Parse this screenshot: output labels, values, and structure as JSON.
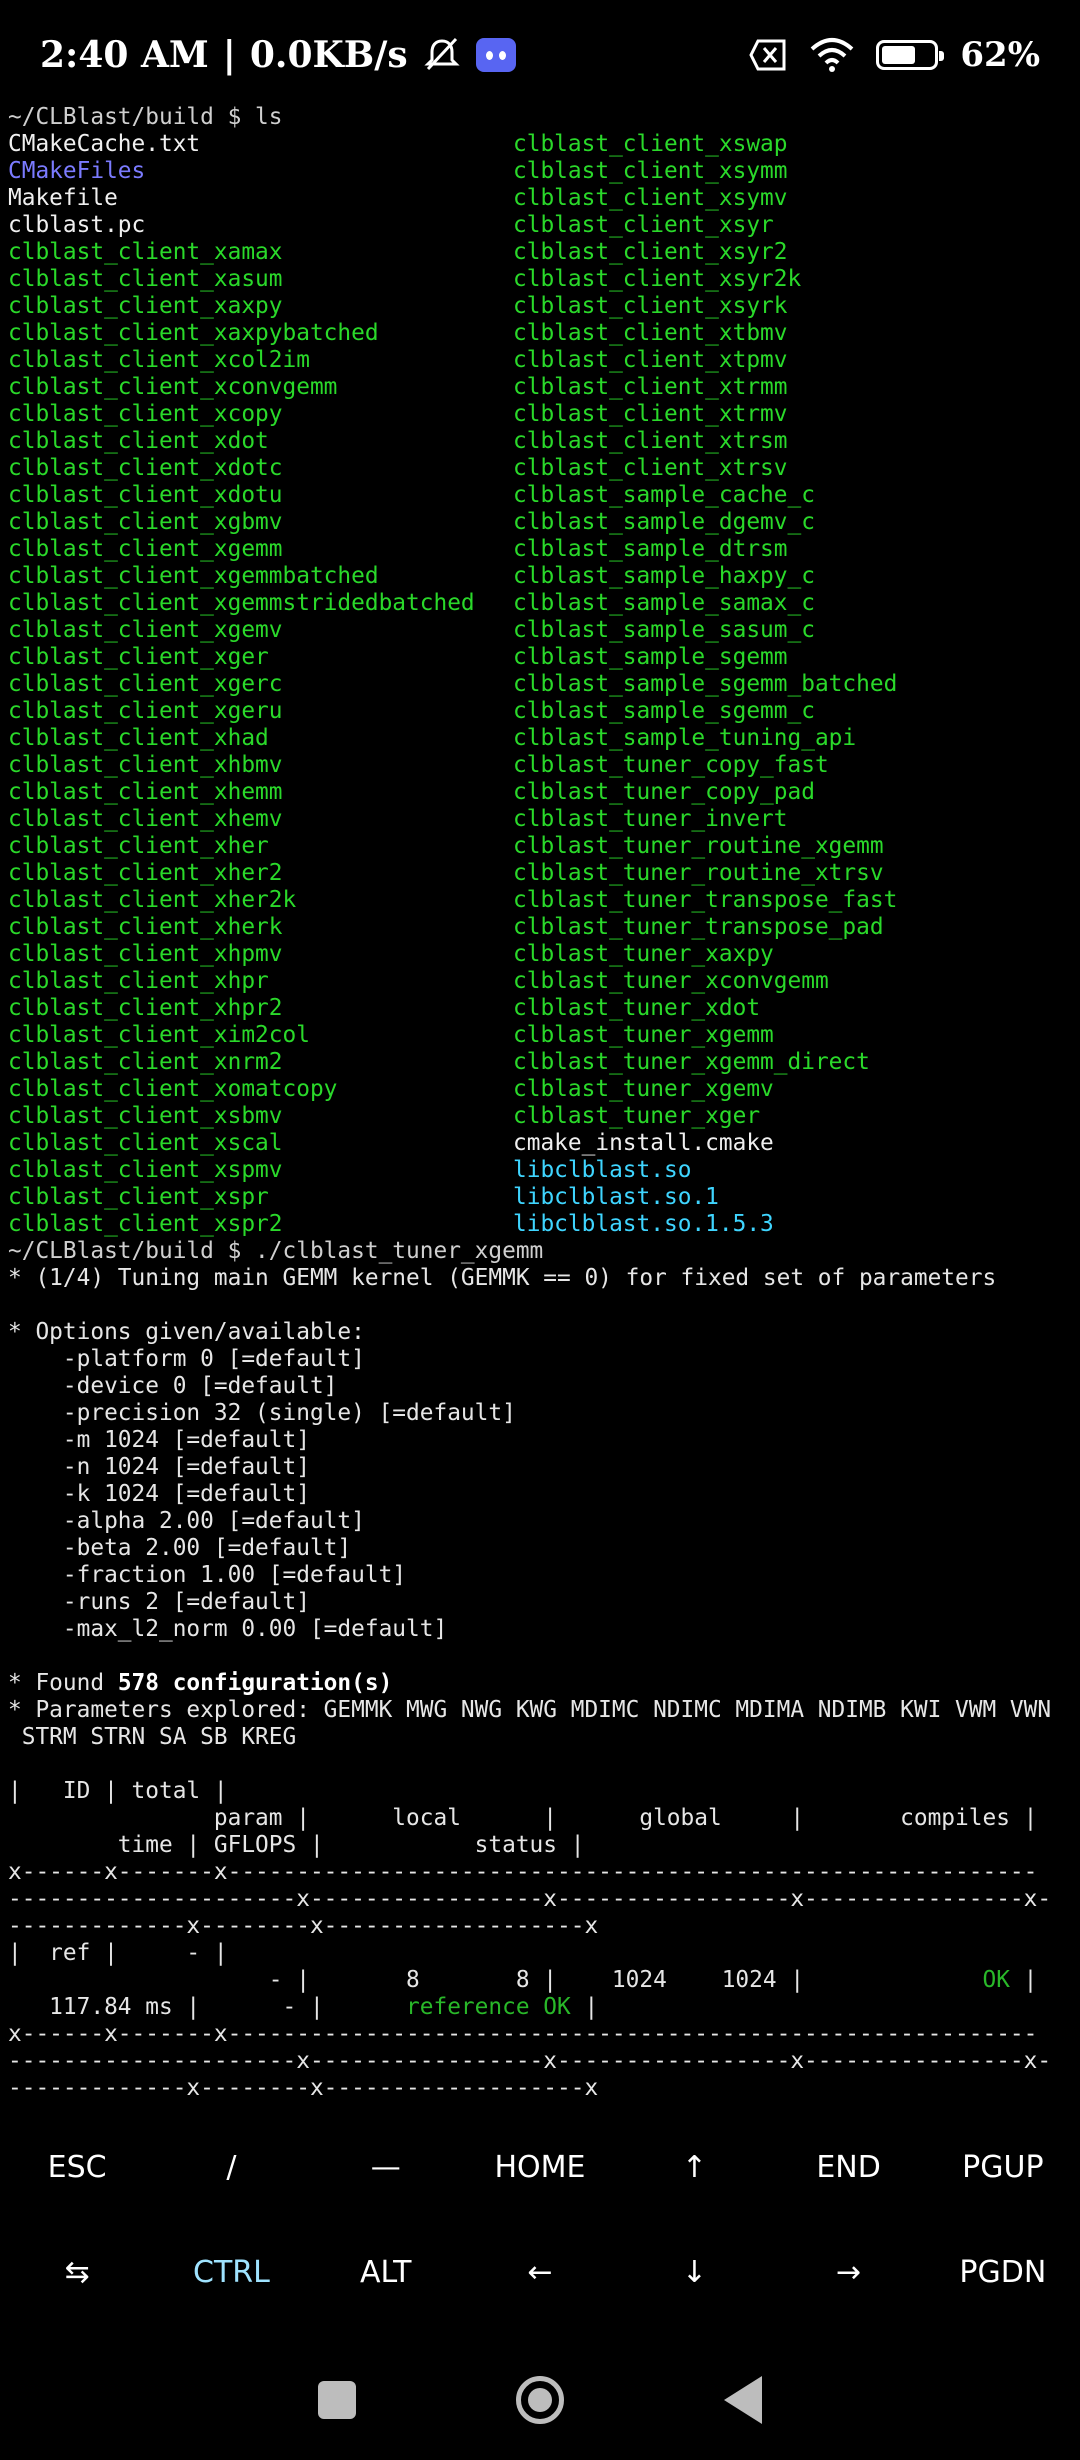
{
  "status": {
    "time": "2:40 AM",
    "separator": "|",
    "speed": "0.0KB/s",
    "battery": "62%",
    "battery_level": 0.62
  },
  "terminal": {
    "prompt1": "~/CLBlast/build $ ls",
    "ls_left": [
      {
        "t": "CMakeCache.txt",
        "k": "plain"
      },
      {
        "t": "CMakeFiles",
        "k": "dir"
      },
      {
        "t": "Makefile",
        "k": "plain"
      },
      {
        "t": "clblast.pc",
        "k": "plain"
      },
      {
        "t": "clblast_client_xamax",
        "k": "exe"
      },
      {
        "t": "clblast_client_xasum",
        "k": "exe"
      },
      {
        "t": "clblast_client_xaxpy",
        "k": "exe"
      },
      {
        "t": "clblast_client_xaxpybatched",
        "k": "exe"
      },
      {
        "t": "clblast_client_xcol2im",
        "k": "exe"
      },
      {
        "t": "clblast_client_xconvgemm",
        "k": "exe"
      },
      {
        "t": "clblast_client_xcopy",
        "k": "exe"
      },
      {
        "t": "clblast_client_xdot",
        "k": "exe"
      },
      {
        "t": "clblast_client_xdotc",
        "k": "exe"
      },
      {
        "t": "clblast_client_xdotu",
        "k": "exe"
      },
      {
        "t": "clblast_client_xgbmv",
        "k": "exe"
      },
      {
        "t": "clblast_client_xgemm",
        "k": "exe"
      },
      {
        "t": "clblast_client_xgemmbatched",
        "k": "exe"
      },
      {
        "t": "clblast_client_xgemmstridedbatched",
        "k": "exe"
      },
      {
        "t": "clblast_client_xgemv",
        "k": "exe"
      },
      {
        "t": "clblast_client_xger",
        "k": "exe"
      },
      {
        "t": "clblast_client_xgerc",
        "k": "exe"
      },
      {
        "t": "clblast_client_xgeru",
        "k": "exe"
      },
      {
        "t": "clblast_client_xhad",
        "k": "exe"
      },
      {
        "t": "clblast_client_xhbmv",
        "k": "exe"
      },
      {
        "t": "clblast_client_xhemm",
        "k": "exe"
      },
      {
        "t": "clblast_client_xhemv",
        "k": "exe"
      },
      {
        "t": "clblast_client_xher",
        "k": "exe"
      },
      {
        "t": "clblast_client_xher2",
        "k": "exe"
      },
      {
        "t": "clblast_client_xher2k",
        "k": "exe"
      },
      {
        "t": "clblast_client_xherk",
        "k": "exe"
      },
      {
        "t": "clblast_client_xhpmv",
        "k": "exe"
      },
      {
        "t": "clblast_client_xhpr",
        "k": "exe"
      },
      {
        "t": "clblast_client_xhpr2",
        "k": "exe"
      },
      {
        "t": "clblast_client_xim2col",
        "k": "exe"
      },
      {
        "t": "clblast_client_xnrm2",
        "k": "exe"
      },
      {
        "t": "clblast_client_xomatcopy",
        "k": "exe"
      },
      {
        "t": "clblast_client_xsbmv",
        "k": "exe"
      },
      {
        "t": "clblast_client_xscal",
        "k": "exe"
      },
      {
        "t": "clblast_client_xspmv",
        "k": "exe"
      },
      {
        "t": "clblast_client_xspr",
        "k": "exe"
      },
      {
        "t": "clblast_client_xspr2",
        "k": "exe"
      }
    ],
    "ls_right": [
      {
        "t": "clblast_client_xswap",
        "k": "exe"
      },
      {
        "t": "clblast_client_xsymm",
        "k": "exe"
      },
      {
        "t": "clblast_client_xsymv",
        "k": "exe"
      },
      {
        "t": "clblast_client_xsyr",
        "k": "exe"
      },
      {
        "t": "clblast_client_xsyr2",
        "k": "exe"
      },
      {
        "t": "clblast_client_xsyr2k",
        "k": "exe"
      },
      {
        "t": "clblast_client_xsyrk",
        "k": "exe"
      },
      {
        "t": "clblast_client_xtbmv",
        "k": "exe"
      },
      {
        "t": "clblast_client_xtpmv",
        "k": "exe"
      },
      {
        "t": "clblast_client_xtrmm",
        "k": "exe"
      },
      {
        "t": "clblast_client_xtrmv",
        "k": "exe"
      },
      {
        "t": "clblast_client_xtrsm",
        "k": "exe"
      },
      {
        "t": "clblast_client_xtrsv",
        "k": "exe"
      },
      {
        "t": "clblast_sample_cache_c",
        "k": "exe"
      },
      {
        "t": "clblast_sample_dgemv_c",
        "k": "exe"
      },
      {
        "t": "clblast_sample_dtrsm",
        "k": "exe"
      },
      {
        "t": "clblast_sample_haxpy_c",
        "k": "exe"
      },
      {
        "t": "clblast_sample_samax_c",
        "k": "exe"
      },
      {
        "t": "clblast_sample_sasum_c",
        "k": "exe"
      },
      {
        "t": "clblast_sample_sgemm",
        "k": "exe"
      },
      {
        "t": "clblast_sample_sgemm_batched",
        "k": "exe"
      },
      {
        "t": "clblast_sample_sgemm_c",
        "k": "exe"
      },
      {
        "t": "clblast_sample_tuning_api",
        "k": "exe"
      },
      {
        "t": "clblast_tuner_copy_fast",
        "k": "exe"
      },
      {
        "t": "clblast_tuner_copy_pad",
        "k": "exe"
      },
      {
        "t": "clblast_tuner_invert",
        "k": "exe"
      },
      {
        "t": "clblast_tuner_routine_xgemm",
        "k": "exe"
      },
      {
        "t": "clblast_tuner_routine_xtrsv",
        "k": "exe"
      },
      {
        "t": "clblast_tuner_transpose_fast",
        "k": "exe"
      },
      {
        "t": "clblast_tuner_transpose_pad",
        "k": "exe"
      },
      {
        "t": "clblast_tuner_xaxpy",
        "k": "exe"
      },
      {
        "t": "clblast_tuner_xconvgemm",
        "k": "exe"
      },
      {
        "t": "clblast_tuner_xdot",
        "k": "exe"
      },
      {
        "t": "clblast_tuner_xgemm",
        "k": "exe"
      },
      {
        "t": "clblast_tuner_xgemm_direct",
        "k": "exe"
      },
      {
        "t": "clblast_tuner_xgemv",
        "k": "exe"
      },
      {
        "t": "clblast_tuner_xger",
        "k": "exe"
      },
      {
        "t": "cmake_install.cmake",
        "k": "plain"
      },
      {
        "t": "libclblast.so",
        "k": "lnk"
      },
      {
        "t": "libclblast.so.1",
        "k": "lnk"
      },
      {
        "t": "libclblast.so.1.5.3",
        "k": "lnk"
      }
    ],
    "prompt2": "~/CLBlast/build $ ./clblast_tuner_xgemm",
    "tuning_line": "* (1/4) Tuning main GEMM kernel (GEMMK == 0) for fixed set of parameters",
    "options_header": "* Options given/available:",
    "options": [
      "    -platform 0 [=default]",
      "    -device 0 [=default]",
      "    -precision 32 (single) [=default]",
      "    -m 1024 [=default]",
      "    -n 1024 [=default]",
      "    -k 1024 [=default]",
      "    -alpha 2.00 [=default]",
      "    -beta 2.00 [=default]",
      "    -fraction 1.00 [=default]",
      "    -runs 2 [=default]",
      "    -max_l2_norm 0.00 [=default]"
    ],
    "found_prefix": "* Found ",
    "found_count": "578 configuration(s)",
    "params_line1": "* Parameters explored: GEMMK MWG NWG KWG MDIMC NDIMC MDIMA NDIMB KWI VWM VWN",
    "params_line2": " STRM STRN SA SB KREG",
    "table": {
      "h1": "|   ID | total |",
      "h2": "               param |      local      |      global     |       compiles |",
      "h3": "        time | GFLOPS |           status |",
      "sep1": "x------x-------x-----------------------------------------------------------",
      "sep2": "---------------------x-----------------x-----------------x----------------x-",
      "sep3": "-------------x--------x-------------------x",
      "ref1": "|  ref |     - |",
      "ref2a": "                   - |       8       8 |    1024    1024 |             ",
      "ref2b": "OK",
      "ref2c": " |",
      "ref3a": "   117.84 ms |      - |      ",
      "ref3b": "reference OK",
      "ref3c": " |"
    }
  },
  "keys_row1": [
    "ESC",
    "/",
    "—",
    "HOME",
    "↑",
    "END",
    "PGUP"
  ],
  "keys_row2": [
    "⇆",
    "CTRL",
    "ALT",
    "←",
    "↓",
    "→",
    "PGDN"
  ]
}
